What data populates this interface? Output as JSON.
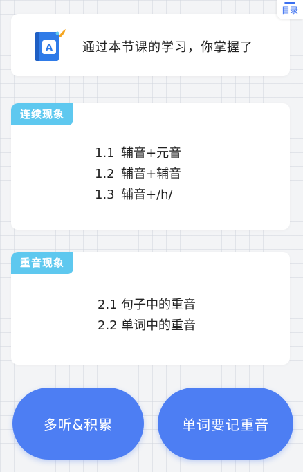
{
  "toc": {
    "label": "目录"
  },
  "intro": {
    "text": "通过本节课的学习，你掌握了",
    "icon": "book-icon"
  },
  "sections": [
    {
      "tag": "连续现象",
      "items": [
        {
          "num": "1.1",
          "text": "辅音+元音"
        },
        {
          "num": "1.2",
          "text": "辅音+辅音"
        },
        {
          "num": "1.3",
          "text": "辅音+/h/"
        }
      ]
    },
    {
      "tag": "重音现象",
      "items": [
        {
          "num": "2.1",
          "text": "句子中的重音"
        },
        {
          "num": "2.2",
          "text": "单词中的重音"
        }
      ]
    }
  ],
  "buttons": {
    "left": "多听&积累",
    "right": "单词要记重音"
  },
  "colors": {
    "accent": "#4d7ef3",
    "tag": "#5ec8ef",
    "background": "#f3f4f6"
  }
}
